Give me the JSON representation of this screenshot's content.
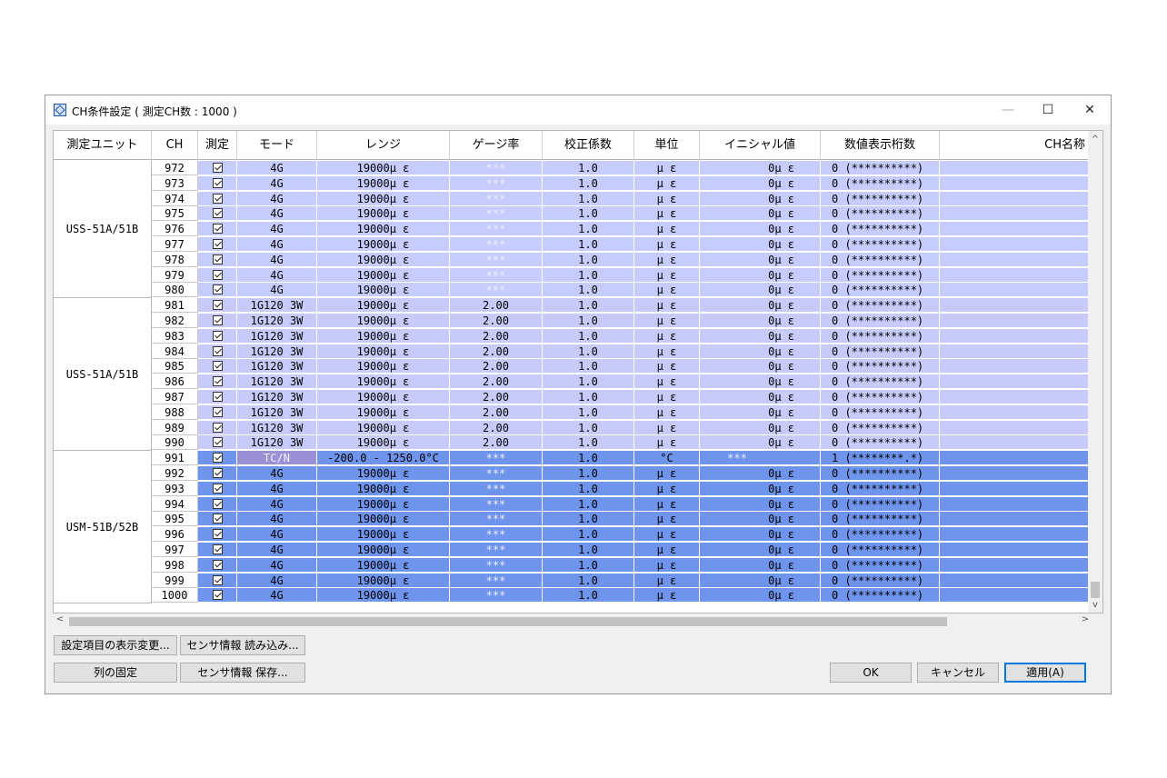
{
  "window": {
    "title": "CH条件設定 ( 測定CH数 : 1000 )",
    "minimize_glyph": "—",
    "maximize_glyph": "☐",
    "close_glyph": "✕"
  },
  "columns": [
    "測定ユニット",
    "CH",
    "測定",
    "モード",
    "レンジ",
    "ゲージ率",
    "校正係数",
    "単位",
    "イニシャル値",
    "数値表示桁数",
    "CH名称"
  ],
  "groups": [
    {
      "name": "USS-51A/51B",
      "rows": [
        {
          "ch": "972",
          "mode": "4G",
          "range": "19000μ ε",
          "gauge": "***",
          "cal": "1.0",
          "unit": "μ ε",
          "initial": "0μ ε",
          "digits": "0 (**********)"
        },
        {
          "ch": "973",
          "mode": "4G",
          "range": "19000μ ε",
          "gauge": "***",
          "cal": "1.0",
          "unit": "μ ε",
          "initial": "0μ ε",
          "digits": "0 (**********)"
        },
        {
          "ch": "974",
          "mode": "4G",
          "range": "19000μ ε",
          "gauge": "***",
          "cal": "1.0",
          "unit": "μ ε",
          "initial": "0μ ε",
          "digits": "0 (**********)"
        },
        {
          "ch": "975",
          "mode": "4G",
          "range": "19000μ ε",
          "gauge": "***",
          "cal": "1.0",
          "unit": "μ ε",
          "initial": "0μ ε",
          "digits": "0 (**********)"
        },
        {
          "ch": "976",
          "mode": "4G",
          "range": "19000μ ε",
          "gauge": "***",
          "cal": "1.0",
          "unit": "μ ε",
          "initial": "0μ ε",
          "digits": "0 (**********)"
        },
        {
          "ch": "977",
          "mode": "4G",
          "range": "19000μ ε",
          "gauge": "***",
          "cal": "1.0",
          "unit": "μ ε",
          "initial": "0μ ε",
          "digits": "0 (**********)"
        },
        {
          "ch": "978",
          "mode": "4G",
          "range": "19000μ ε",
          "gauge": "***",
          "cal": "1.0",
          "unit": "μ ε",
          "initial": "0μ ε",
          "digits": "0 (**********)"
        },
        {
          "ch": "979",
          "mode": "4G",
          "range": "19000μ ε",
          "gauge": "***",
          "cal": "1.0",
          "unit": "μ ε",
          "initial": "0μ ε",
          "digits": "0 (**********)"
        },
        {
          "ch": "980",
          "mode": "4G",
          "range": "19000μ ε",
          "gauge": "***",
          "cal": "1.0",
          "unit": "μ ε",
          "initial": "0μ ε",
          "digits": "0 (**********)"
        }
      ]
    },
    {
      "name": "USS-51A/51B",
      "rows": [
        {
          "ch": "981",
          "mode": "1G120 3W",
          "range": "19000μ ε",
          "gauge": "2.00",
          "cal": "1.0",
          "unit": "μ ε",
          "initial": "0μ ε",
          "digits": "0 (**********)"
        },
        {
          "ch": "982",
          "mode": "1G120 3W",
          "range": "19000μ ε",
          "gauge": "2.00",
          "cal": "1.0",
          "unit": "μ ε",
          "initial": "0μ ε",
          "digits": "0 (**********)"
        },
        {
          "ch": "983",
          "mode": "1G120 3W",
          "range": "19000μ ε",
          "gauge": "2.00",
          "cal": "1.0",
          "unit": "μ ε",
          "initial": "0μ ε",
          "digits": "0 (**********)"
        },
        {
          "ch": "984",
          "mode": "1G120 3W",
          "range": "19000μ ε",
          "gauge": "2.00",
          "cal": "1.0",
          "unit": "μ ε",
          "initial": "0μ ε",
          "digits": "0 (**********)"
        },
        {
          "ch": "985",
          "mode": "1G120 3W",
          "range": "19000μ ε",
          "gauge": "2.00",
          "cal": "1.0",
          "unit": "μ ε",
          "initial": "0μ ε",
          "digits": "0 (**********)"
        },
        {
          "ch": "986",
          "mode": "1G120 3W",
          "range": "19000μ ε",
          "gauge": "2.00",
          "cal": "1.0",
          "unit": "μ ε",
          "initial": "0μ ε",
          "digits": "0 (**********)"
        },
        {
          "ch": "987",
          "mode": "1G120 3W",
          "range": "19000μ ε",
          "gauge": "2.00",
          "cal": "1.0",
          "unit": "μ ε",
          "initial": "0μ ε",
          "digits": "0 (**********)"
        },
        {
          "ch": "988",
          "mode": "1G120 3W",
          "range": "19000μ ε",
          "gauge": "2.00",
          "cal": "1.0",
          "unit": "μ ε",
          "initial": "0μ ε",
          "digits": "0 (**********)"
        },
        {
          "ch": "989",
          "mode": "1G120 3W",
          "range": "19000μ ε",
          "gauge": "2.00",
          "cal": "1.0",
          "unit": "μ ε",
          "initial": "0μ ε",
          "digits": "0 (**********)"
        },
        {
          "ch": "990",
          "mode": "1G120 3W",
          "range": "19000μ ε",
          "gauge": "2.00",
          "cal": "1.0",
          "unit": "μ ε",
          "initial": "0μ ε",
          "digits": "0 (**********)"
        }
      ]
    },
    {
      "name": "USM-51B/52B",
      "rows": [
        {
          "ch": "991",
          "mode": "TC/N",
          "range": "-200.0 - 1250.0°C",
          "gauge": "***",
          "cal": "1.0",
          "unit": "°C",
          "initial": "***",
          "digits": "1 (********.*)"
        },
        {
          "ch": "992",
          "mode": "4G",
          "range": "19000μ ε",
          "gauge": "***",
          "cal": "1.0",
          "unit": "μ ε",
          "initial": "0μ ε",
          "digits": "0 (**********)"
        },
        {
          "ch": "993",
          "mode": "4G",
          "range": "19000μ ε",
          "gauge": "***",
          "cal": "1.0",
          "unit": "μ ε",
          "initial": "0μ ε",
          "digits": "0 (**********)"
        },
        {
          "ch": "994",
          "mode": "4G",
          "range": "19000μ ε",
          "gauge": "***",
          "cal": "1.0",
          "unit": "μ ε",
          "initial": "0μ ε",
          "digits": "0 (**********)"
        },
        {
          "ch": "995",
          "mode": "4G",
          "range": "19000μ ε",
          "gauge": "***",
          "cal": "1.0",
          "unit": "μ ε",
          "initial": "0μ ε",
          "digits": "0 (**********)"
        },
        {
          "ch": "996",
          "mode": "4G",
          "range": "19000μ ε",
          "gauge": "***",
          "cal": "1.0",
          "unit": "μ ε",
          "initial": "0μ ε",
          "digits": "0 (**********)"
        },
        {
          "ch": "997",
          "mode": "4G",
          "range": "19000μ ε",
          "gauge": "***",
          "cal": "1.0",
          "unit": "μ ε",
          "initial": "0μ ε",
          "digits": "0 (**********)"
        },
        {
          "ch": "998",
          "mode": "4G",
          "range": "19000μ ε",
          "gauge": "***",
          "cal": "1.0",
          "unit": "μ ε",
          "initial": "0μ ε",
          "digits": "0 (**********)"
        },
        {
          "ch": "999",
          "mode": "4G",
          "range": "19000μ ε",
          "gauge": "***",
          "cal": "1.0",
          "unit": "μ ε",
          "initial": "0μ ε",
          "digits": "0 (**********)"
        },
        {
          "ch": "1000",
          "mode": "4G",
          "range": "19000μ ε",
          "gauge": "***",
          "cal": "1.0",
          "unit": "μ ε",
          "initial": "0μ ε",
          "digits": "0 (**********)"
        }
      ]
    }
  ],
  "colors": {
    "group_a": "#c6ccfd",
    "group_b": "#c8cbfa",
    "group_c": "#6f94ec",
    "tc_mode_cell": "#9b8fd6",
    "dim_text": "#ececff",
    "accent": "#0078d7"
  },
  "buttons": {
    "display_change": "設定項目の表示変更...",
    "sensor_load": "センサ情報 読み込み...",
    "fix_columns": "列の固定",
    "sensor_save": "センサ情報 保存...",
    "ok": "OK",
    "cancel": "キャンセル",
    "apply": "適用(A)"
  },
  "icons": {
    "scroll_up": "^",
    "scroll_down": "v",
    "scroll_left": "<",
    "scroll_right": ">"
  }
}
